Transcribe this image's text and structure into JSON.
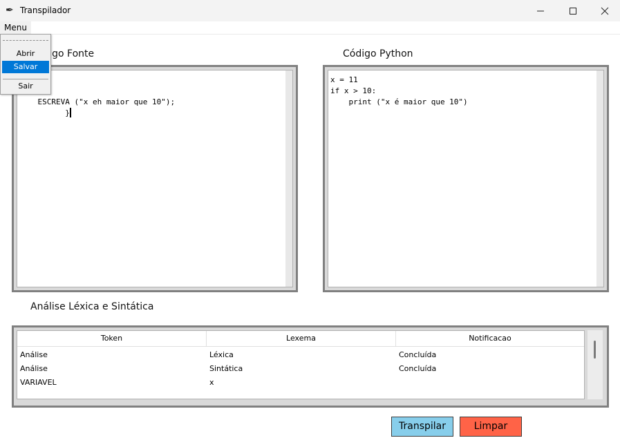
{
  "window": {
    "title": "Transpilador",
    "app_icon": "feather-icon"
  },
  "menubar": {
    "menu_label": "Menu"
  },
  "dropdown": {
    "items": [
      "Abrir",
      "Salvar",
      "Sair"
    ],
    "selected": "Salvar",
    "selected_color": "#0078d7"
  },
  "source": {
    "label": "Código Fonte",
    "code": ";\n    10{\n    ESCREVA (\"x eh maior que 10\");\n          }"
  },
  "python": {
    "label": "Código Python",
    "code": "x = 11\nif x > 10:\n    print (\"x é maior que 10\")"
  },
  "analysis": {
    "label": "Análise Léxica e Sintática",
    "columns": [
      "Token",
      "Lexema",
      "Notificacao"
    ],
    "rows": [
      [
        "Análise",
        "Léxica",
        "Concluída"
      ],
      [
        "Análise",
        "Sintática",
        "Concluída"
      ],
      [
        "VARIAVEL",
        "x",
        ""
      ]
    ]
  },
  "buttons": {
    "transpile": {
      "label": "Transpilar",
      "color": "#87ceeb"
    },
    "clear": {
      "label": "Limpar",
      "color": "#ff6347"
    }
  }
}
